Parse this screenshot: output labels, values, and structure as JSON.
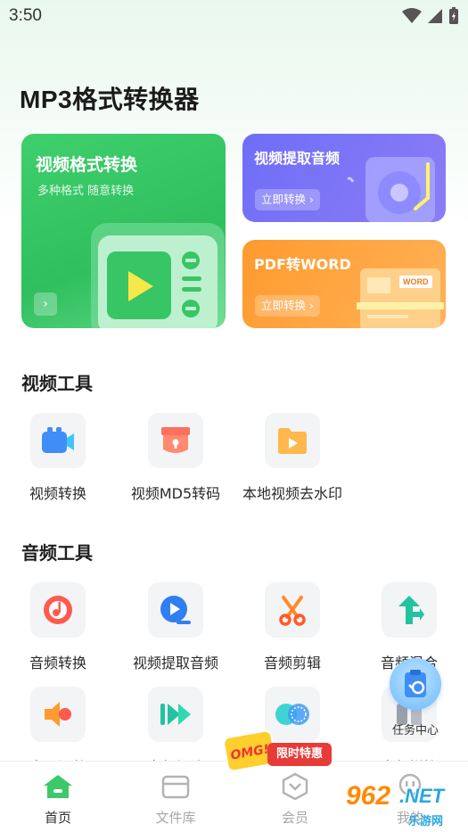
{
  "status_bar": {
    "time": "3:50"
  },
  "app": {
    "title": "MP3格式转换器"
  },
  "cards": {
    "main": {
      "title": "视频格式转换",
      "subtitle": "多种格式 随意转换",
      "arrow": "›"
    },
    "audio_extract": {
      "title": "视频提取音频",
      "button": "立即转换 ›"
    },
    "pdf": {
      "title": "PDF转WORD",
      "button": "立即转换 ›",
      "badge": "WORD"
    }
  },
  "sections": {
    "video_tools": {
      "title": "视频工具",
      "items": [
        {
          "label": "视频转换",
          "icon": "video-camera-icon"
        },
        {
          "label": "视频MD5转码",
          "icon": "md5-box-icon"
        },
        {
          "label": "本地视频去水印",
          "icon": "folder-play-icon"
        }
      ]
    },
    "audio_tools": {
      "title": "音频工具",
      "items": [
        {
          "label": "音频转换",
          "icon": "music-disc-icon"
        },
        {
          "label": "视频提取音频",
          "icon": "extract-audio-icon"
        },
        {
          "label": "音频剪辑",
          "icon": "scissors-icon"
        },
        {
          "label": "音频混合",
          "icon": "merge-arrows-icon"
        },
        {
          "label": "音量调整",
          "icon": "speaker-icon"
        },
        {
          "label": "音频加速",
          "icon": "fast-forward-icon"
        },
        {
          "label": "",
          "icon": "overlap-circles-icon"
        },
        {
          "label": "音频拼接",
          "icon": "splice-icon"
        }
      ]
    }
  },
  "floating": {
    "task_center": "任务中心"
  },
  "promo": {
    "tag": "限时特惠",
    "burst": "OMG!"
  },
  "tabs": [
    {
      "label": "首页",
      "icon": "home-icon",
      "active": true
    },
    {
      "label": "文件库",
      "icon": "folder-icon",
      "active": false
    },
    {
      "label": "会员",
      "icon": "vip-shield-icon",
      "active": false
    },
    {
      "label": "我的",
      "icon": "profile-icon",
      "active": false
    }
  ],
  "watermark": {
    "number": "962",
    "net": ".NET",
    "sub": "乐游网"
  },
  "colors": {
    "brand_green": "#2fbf5e",
    "card_purple": "#7a74f6",
    "card_orange": "#ff9f3a",
    "promo_red": "#e63b37"
  }
}
